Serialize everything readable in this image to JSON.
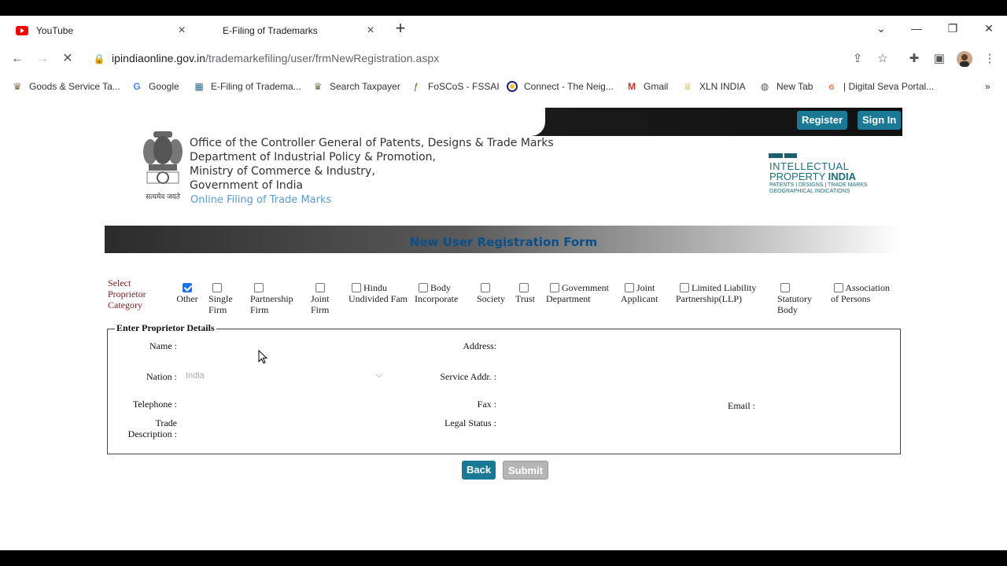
{
  "browser": {
    "tabs": [
      {
        "title": "YouTube",
        "icon": "youtube-icon"
      },
      {
        "title": "E-Filing of Trademarks",
        "icon": "loading-icon"
      }
    ],
    "url_domain": "ipindiaonline.gov.in",
    "url_path": "/trademarkefiling/user/frmNewRegistration.aspx",
    "bookmarks": [
      {
        "label": "Goods & Service Ta...",
        "icon": "gst-icon"
      },
      {
        "label": "Google",
        "icon": "google-icon"
      },
      {
        "label": "E-Filing of Tradema...",
        "icon": "ip-icon"
      },
      {
        "label": "Search Taxpayer",
        "icon": "gst-icon"
      },
      {
        "label": "FoSCoS - FSSAI",
        "icon": "fssai-icon"
      },
      {
        "label": "Connect - The Neig...",
        "icon": "connect-icon"
      },
      {
        "label": "Gmail",
        "icon": "gmail-icon"
      },
      {
        "label": "XLN INDIA",
        "icon": "xln-icon"
      },
      {
        "label": "New Tab",
        "icon": "globe-icon"
      },
      {
        "label": "| Digital Seva Portal...",
        "icon": "digital-seva-icon"
      }
    ]
  },
  "header": {
    "register": "Register",
    "signin": "Sign In",
    "office_lines": [
      "Office of the Controller General of Patents, Designs & Trade Marks",
      "Department of Industrial Policy & Promotion,",
      "Ministry of Commerce & Industry,",
      "Government of India"
    ],
    "online_filing": "Online Filing of Trade Marks",
    "emblem_motto": "सत्यमेव जयते",
    "logo": {
      "line1": "INTELLECTUAL",
      "line2a": "PROPERTY ",
      "line2b": "INDIA",
      "line3": "PATENTS | DESIGNS | TRADE MARKS",
      "line4": "GEOGRAPHICAL INDICATIONS"
    }
  },
  "form": {
    "title": "New User Registration Form",
    "category_label": "Select Proprietor Category",
    "categories": [
      {
        "label": "Other",
        "checked": true
      },
      {
        "label": "Single Firm",
        "checked": false
      },
      {
        "label": "Partnership Firm",
        "checked": false
      },
      {
        "label": "Joint Firm",
        "checked": false
      },
      {
        "label": "Hindu Undivided Fam",
        "checked": false
      },
      {
        "label": "Body Incorporate",
        "checked": false
      },
      {
        "label": "Society",
        "checked": false
      },
      {
        "label": "Trust",
        "checked": false
      },
      {
        "label": "Government Department",
        "checked": false
      },
      {
        "label": "Joint Applicant",
        "checked": false
      },
      {
        "label": "Limited Liability Partnership(LLP)",
        "checked": false
      },
      {
        "label": "Statutory Body",
        "checked": false
      },
      {
        "label": "Association of Persons",
        "checked": false
      }
    ],
    "legend": "Enter Proprietor Details",
    "fields": {
      "name": "Name :",
      "address": "Address:",
      "nation": "Nation :",
      "nation_value": "India",
      "service_addr": "Service Addr. :",
      "telephone": "Telephone :",
      "fax": "Fax :",
      "email": "Email :",
      "trade_desc_1": "Trade",
      "trade_desc_2": "Description :",
      "legal_status": "Legal Status :"
    },
    "back": "Back",
    "submit": "Submit"
  }
}
